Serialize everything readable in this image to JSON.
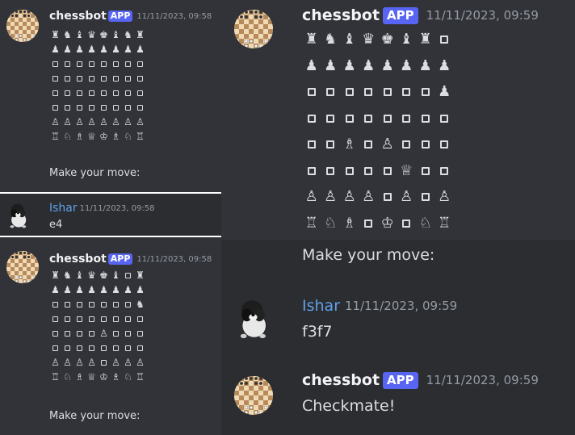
{
  "colors": {
    "background": "#313338",
    "hover_background": "#2b2d31",
    "app_badge": "#5865f2",
    "bot_name": "#f2f3f5",
    "user_name": "#5fa1e8",
    "timestamp": "#949ba4",
    "text": "#dbdee1"
  },
  "left": {
    "msg1": {
      "username": "chessbot",
      "badge": "APP",
      "timestamp": "11/11/2023, 09:58",
      "board": [
        [
          "♜",
          "♞",
          "♝",
          "♛",
          "♚",
          "♝",
          "♞",
          "♜"
        ],
        [
          "♟",
          "♟",
          "♟",
          "♟",
          "♟",
          "♟",
          "♟",
          "♟"
        ],
        [
          "□",
          "□",
          "□",
          "□",
          "□",
          "□",
          "□",
          "□"
        ],
        [
          "□",
          "□",
          "□",
          "□",
          "□",
          "□",
          "□",
          "□"
        ],
        [
          "□",
          "□",
          "□",
          "□",
          "□",
          "□",
          "□",
          "□"
        ],
        [
          "□",
          "□",
          "□",
          "□",
          "□",
          "□",
          "□",
          "□"
        ],
        [
          "♙",
          "♙",
          "♙",
          "♙",
          "♙",
          "♙",
          "♙",
          "♙"
        ],
        [
          "♖",
          "♘",
          "♗",
          "♕",
          "♔",
          "♗",
          "♘",
          "♖"
        ]
      ],
      "prompt": "Make your move:"
    },
    "msg2": {
      "username": "Ishar",
      "timestamp": "11/11/2023, 09:58",
      "text": "e4"
    },
    "msg3": {
      "username": "chessbot",
      "badge": "APP",
      "timestamp": "11/11/2023, 09:58",
      "board": [
        [
          "♜",
          "♞",
          "♝",
          "♛",
          "♚",
          "♝",
          "□",
          "♜"
        ],
        [
          "♟",
          "♟",
          "♟",
          "♟",
          "♟",
          "♟",
          "♟",
          "♟"
        ],
        [
          "□",
          "□",
          "□",
          "□",
          "□",
          "□",
          "□",
          "♞"
        ],
        [
          "□",
          "□",
          "□",
          "□",
          "□",
          "□",
          "□",
          "□"
        ],
        [
          "□",
          "□",
          "□",
          "□",
          "♙",
          "□",
          "□",
          "□"
        ],
        [
          "□",
          "□",
          "□",
          "□",
          "□",
          "□",
          "□",
          "□"
        ],
        [
          "♙",
          "♙",
          "♙",
          "♙",
          "□",
          "♙",
          "♙",
          "♙"
        ],
        [
          "♖",
          "♘",
          "♗",
          "♕",
          "♔",
          "♗",
          "♘",
          "♖"
        ]
      ],
      "prompt": "Make your move:"
    }
  },
  "right": {
    "msg1": {
      "username": "chessbot",
      "badge": "APP",
      "timestamp": "11/11/2023, 09:59",
      "board": [
        [
          "♜",
          "♞",
          "♝",
          "♛",
          "♚",
          "♝",
          "♜",
          "□"
        ],
        [
          "♟",
          "♟",
          "♟",
          "♟",
          "♟",
          "♟",
          "♟",
          "♟"
        ],
        [
          "□",
          "□",
          "□",
          "□",
          "□",
          "□",
          "□",
          "♟"
        ],
        [
          "□",
          "□",
          "□",
          "□",
          "□",
          "□",
          "□",
          "□"
        ],
        [
          "□",
          "□",
          "♗",
          "□",
          "♙",
          "□",
          "□",
          "□"
        ],
        [
          "□",
          "□",
          "□",
          "□",
          "□",
          "♕",
          "□",
          "□"
        ],
        [
          "♙",
          "♙",
          "♙",
          "♙",
          "□",
          "♙",
          "□",
          "♙"
        ],
        [
          "♖",
          "♘",
          "♗",
          "□",
          "♔",
          "□",
          "♘",
          "♖"
        ]
      ],
      "prompt": "Make your move:"
    },
    "msg2": {
      "username": "Ishar",
      "timestamp": "11/11/2023, 09:59",
      "text": "f3f7"
    },
    "msg3": {
      "username": "chessbot",
      "badge": "APP",
      "timestamp": "11/11/2023, 09:59",
      "text": "Checkmate!"
    }
  },
  "icons": {
    "bot_avatar": "chessboard-avatar-icon",
    "user_avatar": "dog-avatar-icon"
  }
}
